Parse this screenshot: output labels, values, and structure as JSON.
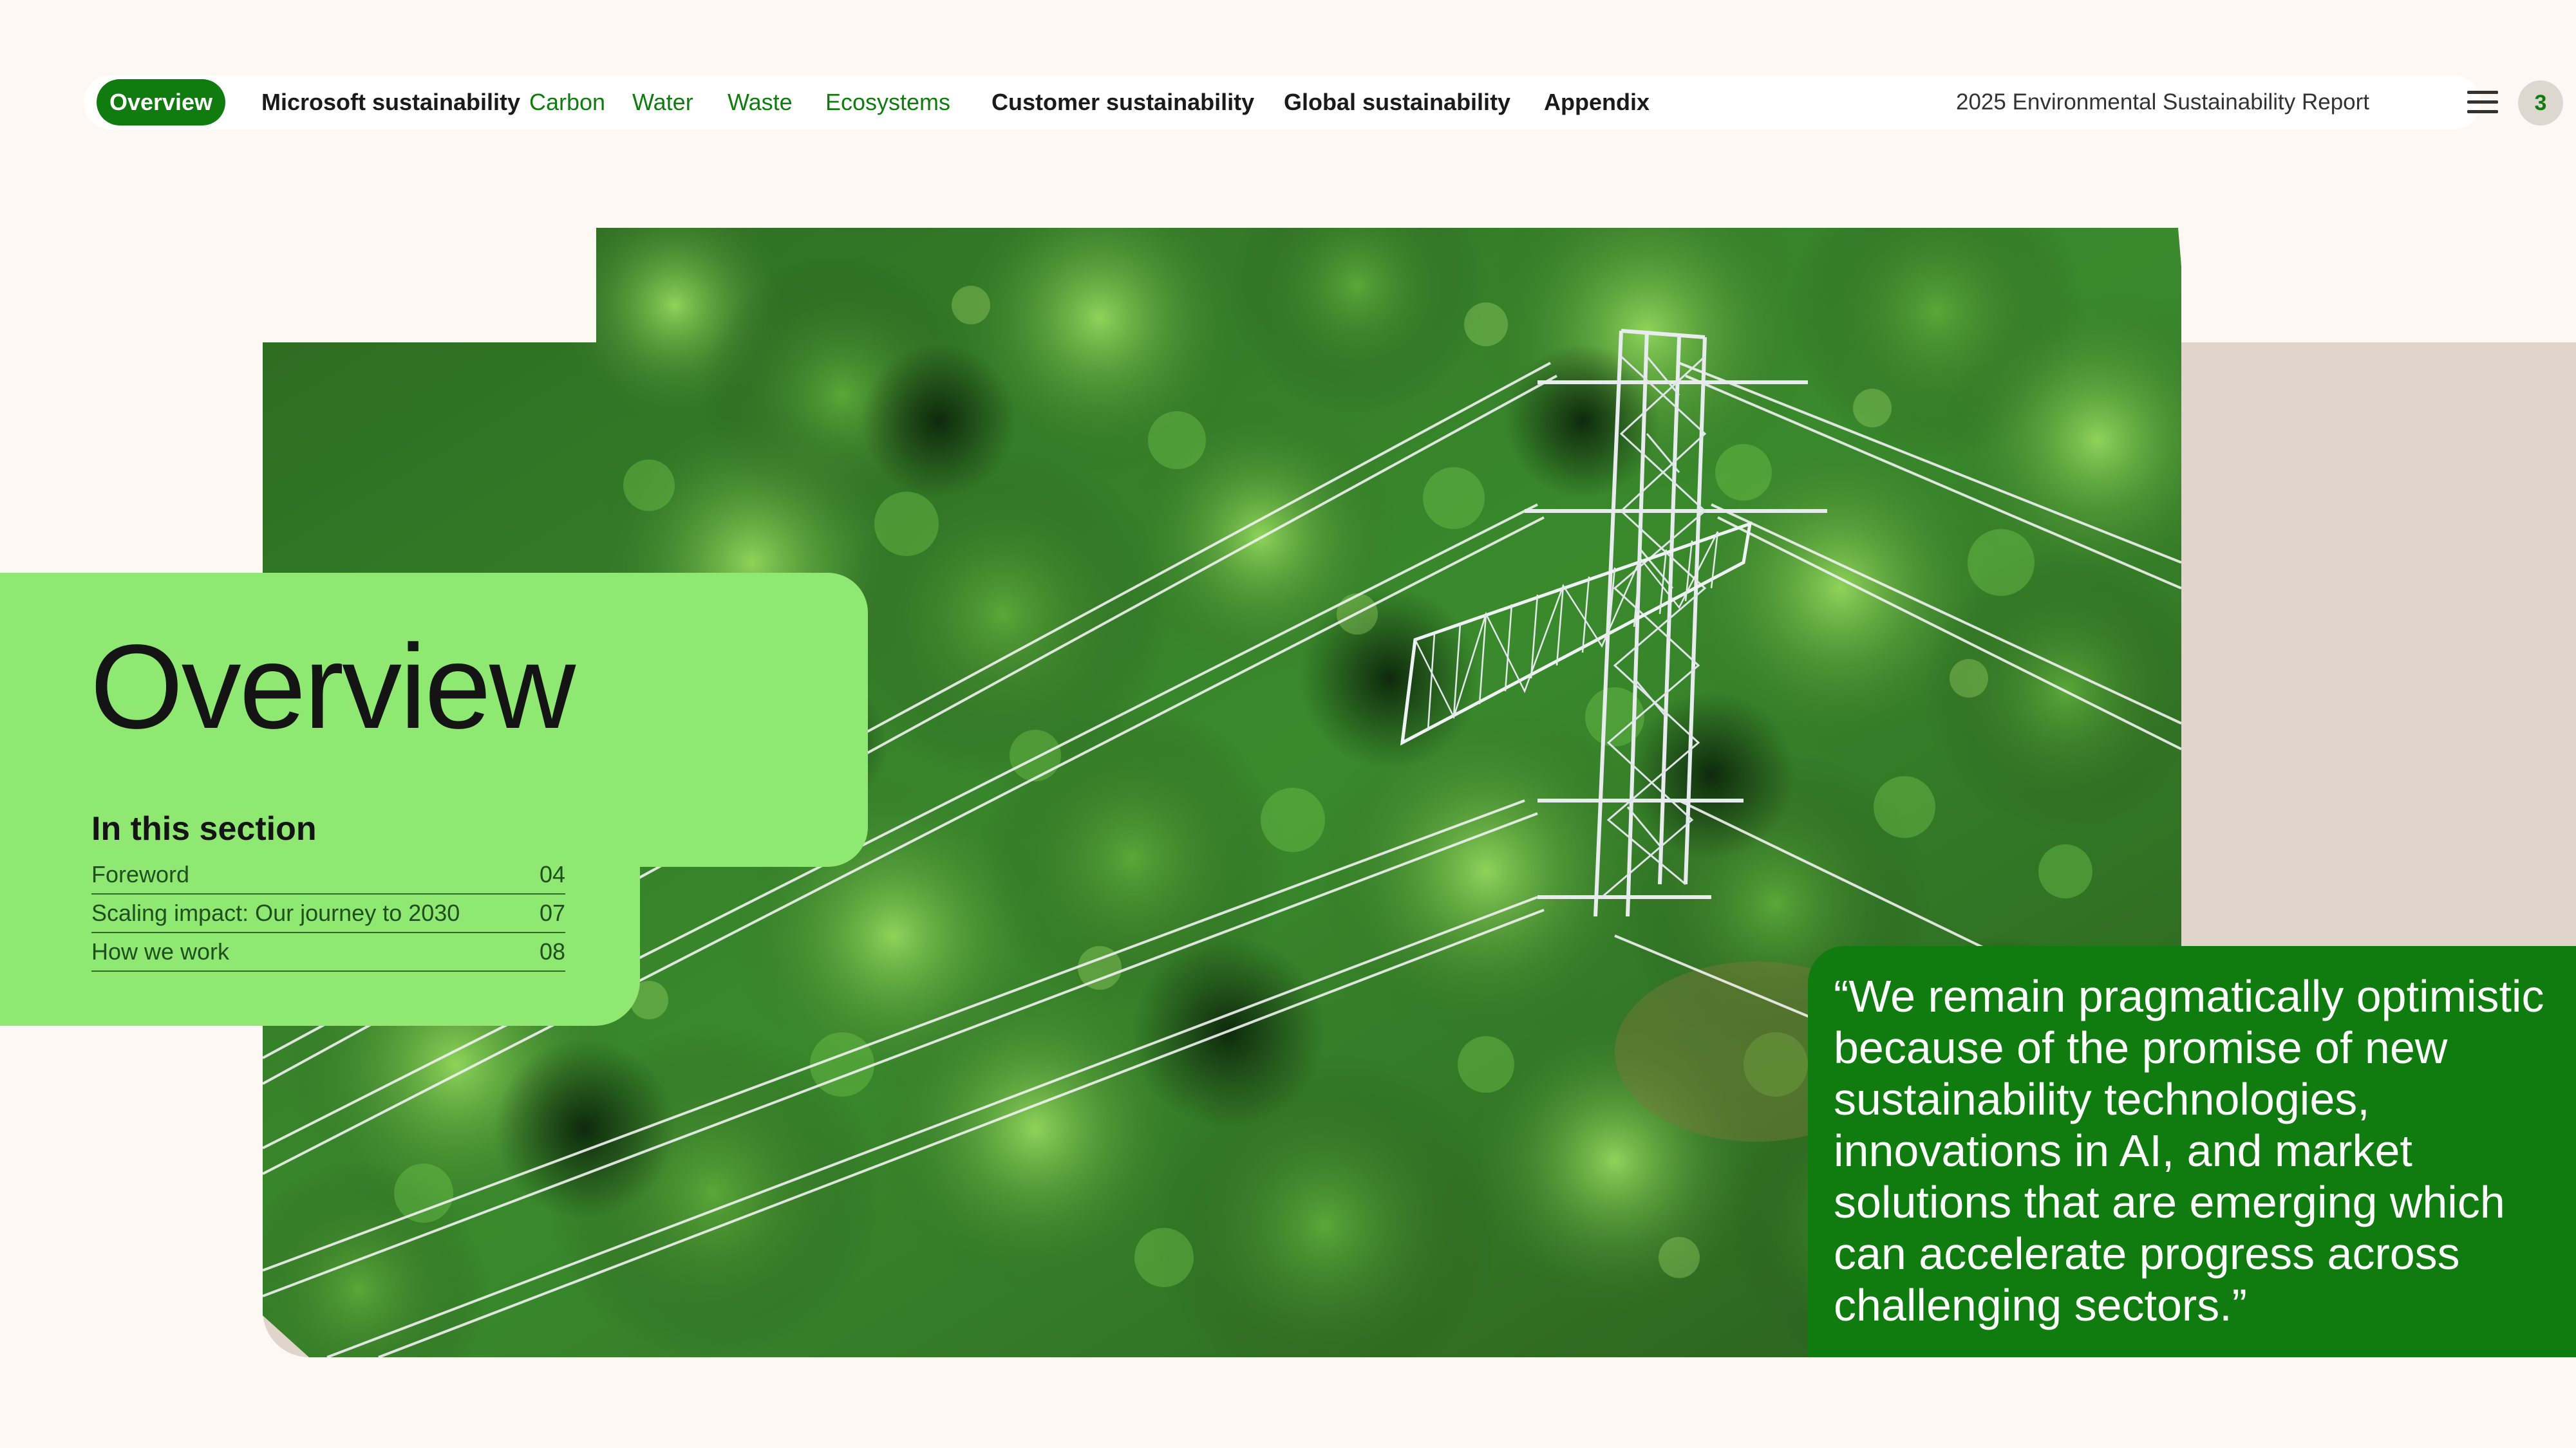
{
  "nav": {
    "active": "Overview",
    "items": [
      "Microsoft sustainability",
      "Carbon",
      "Water",
      "Waste",
      "Ecosystems",
      "Customer sustainability",
      "Global sustainability",
      "Appendix"
    ],
    "report_title": "2025 Environmental Sustainability Report",
    "page_number": "3"
  },
  "card": {
    "title": "Overview",
    "section_heading": "In this section",
    "toc": [
      {
        "label": "Foreword",
        "page": "04"
      },
      {
        "label": "Scaling impact: Our journey to 2030",
        "page": "07"
      },
      {
        "label": "How we work",
        "page": "08"
      }
    ]
  },
  "quote": {
    "text": "“We remain pragmatically optimistic because of the promise of new sustainability technologies, innovations in AI, and market solutions that are emerging which can accelerate progress across challenging sectors.”"
  },
  "colors": {
    "brand_green": "#107c10",
    "light_green": "#8fe872",
    "beige": "#e0d5cb",
    "page_bg": "#fef8f4"
  },
  "icons": [
    "hamburger-menu-icon"
  ]
}
